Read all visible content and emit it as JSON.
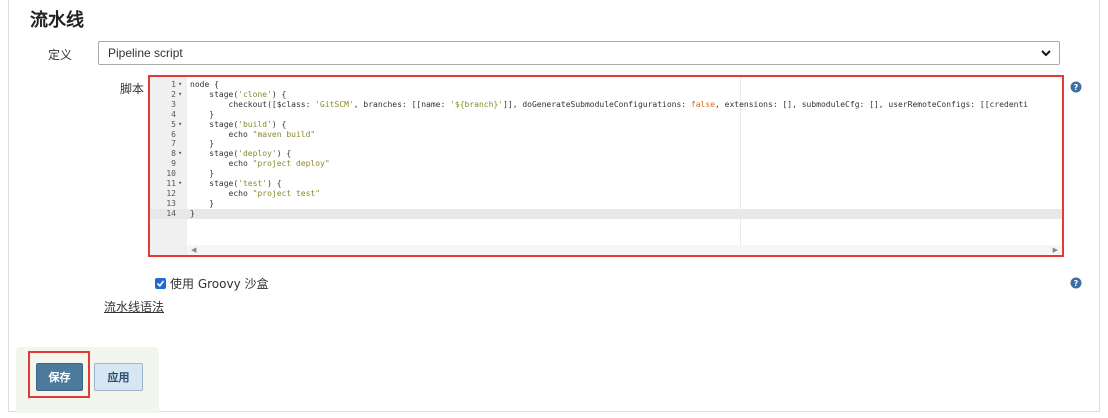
{
  "section": {
    "title": "流水线"
  },
  "definition": {
    "label": "定义",
    "selected": "Pipeline script"
  },
  "script": {
    "label": "脚本",
    "lines": [
      {
        "n": "1",
        "fold": true,
        "segments": [
          {
            "t": "node {",
            "c": ""
          }
        ]
      },
      {
        "n": "2",
        "fold": true,
        "segments": [
          {
            "t": "    stage(",
            "c": ""
          },
          {
            "t": "'clone'",
            "c": "str"
          },
          {
            "t": ") {",
            "c": ""
          }
        ]
      },
      {
        "n": "3",
        "fold": false,
        "segments": [
          {
            "t": "        checkout([$class: ",
            "c": ""
          },
          {
            "t": "'GitSCM'",
            "c": "str"
          },
          {
            "t": ", branches: [[name: ",
            "c": ""
          },
          {
            "t": "'${branch}'",
            "c": "str"
          },
          {
            "t": "]], doGenerateSubmoduleConfigurations: ",
            "c": ""
          },
          {
            "t": "false",
            "c": "kw"
          },
          {
            "t": ", extensions: [], submoduleCfg: [], userRemoteConfigs: [[credenti",
            "c": ""
          }
        ]
      },
      {
        "n": "4",
        "fold": false,
        "segments": [
          {
            "t": "    }",
            "c": ""
          }
        ]
      },
      {
        "n": "5",
        "fold": true,
        "segments": [
          {
            "t": "    stage(",
            "c": ""
          },
          {
            "t": "'build'",
            "c": "str"
          },
          {
            "t": ") {",
            "c": ""
          }
        ]
      },
      {
        "n": "6",
        "fold": false,
        "segments": [
          {
            "t": "        echo ",
            "c": ""
          },
          {
            "t": "\"maven build\"",
            "c": "str"
          }
        ]
      },
      {
        "n": "7",
        "fold": false,
        "segments": [
          {
            "t": "    }",
            "c": ""
          }
        ]
      },
      {
        "n": "8",
        "fold": true,
        "segments": [
          {
            "t": "    stage(",
            "c": ""
          },
          {
            "t": "'deploy'",
            "c": "str"
          },
          {
            "t": ") {",
            "c": ""
          }
        ]
      },
      {
        "n": "9",
        "fold": false,
        "segments": [
          {
            "t": "        echo ",
            "c": ""
          },
          {
            "t": "\"project deploy\"",
            "c": "str"
          }
        ]
      },
      {
        "n": "10",
        "fold": false,
        "segments": [
          {
            "t": "    }",
            "c": ""
          }
        ]
      },
      {
        "n": "11",
        "fold": true,
        "segments": [
          {
            "t": "    stage(",
            "c": ""
          },
          {
            "t": "'test'",
            "c": "str"
          },
          {
            "t": ") {",
            "c": ""
          }
        ]
      },
      {
        "n": "12",
        "fold": false,
        "segments": [
          {
            "t": "        echo ",
            "c": ""
          },
          {
            "t": "\"project test\"",
            "c": "str"
          }
        ]
      },
      {
        "n": "13",
        "fold": false,
        "segments": [
          {
            "t": "    }",
            "c": ""
          }
        ]
      },
      {
        "n": "14",
        "fold": false,
        "active": true,
        "segments": [
          {
            "t": "}",
            "c": ""
          }
        ]
      }
    ]
  },
  "sandbox": {
    "label": "使用 Groovy 沙盒",
    "checked": true
  },
  "syntax_link": "流水线语法",
  "buttons": {
    "save": "保存",
    "apply": "应用"
  },
  "colors": {
    "accent_red": "#e53935",
    "save_bg": "#4b7a9c",
    "apply_bg": "#d7e6f3",
    "checkbox": "#1e6bd6"
  }
}
